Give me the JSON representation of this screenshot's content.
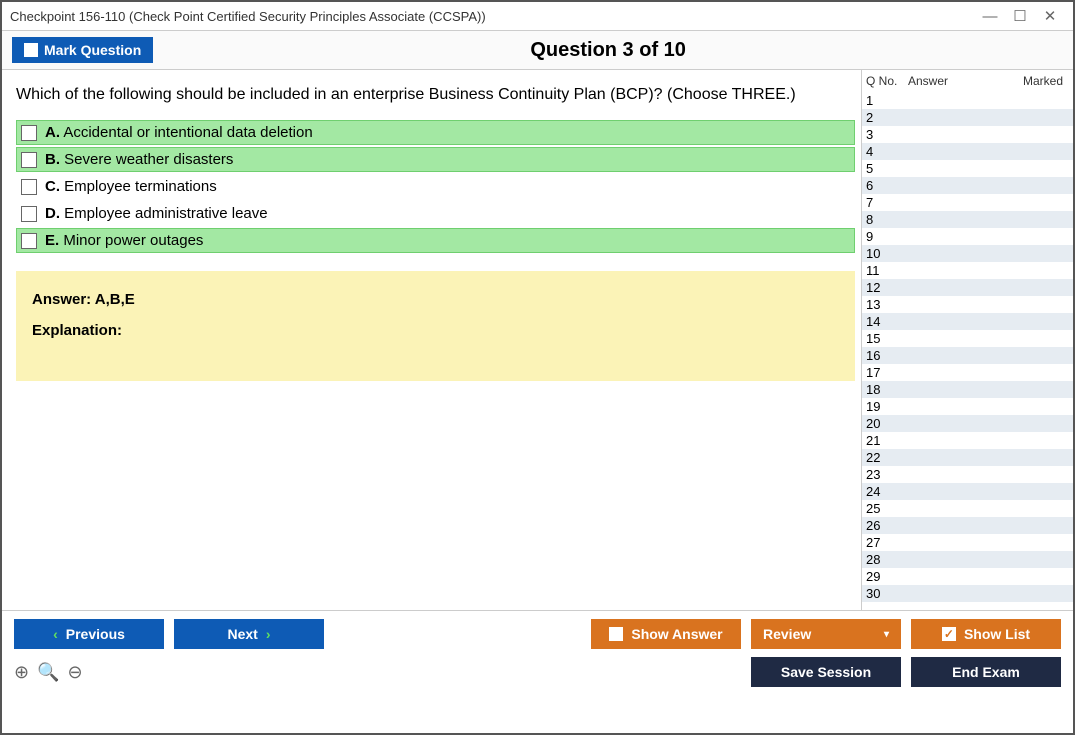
{
  "window": {
    "title": "Checkpoint 156-110 (Check Point Certified Security Principles Associate (CCSPA))"
  },
  "header": {
    "mark_label": "Mark Question",
    "question_title": "Question 3 of 10"
  },
  "question": {
    "text": "Which of the following should be included in an enterprise Business Continuity Plan (BCP)? (Choose THREE.)",
    "options": [
      {
        "letter": "A.",
        "text": "Accidental or intentional data deletion",
        "correct": true
      },
      {
        "letter": "B.",
        "text": "Severe weather disasters",
        "correct": true
      },
      {
        "letter": "C.",
        "text": "Employee terminations",
        "correct": false
      },
      {
        "letter": "D.",
        "text": "Employee administrative leave",
        "correct": false
      },
      {
        "letter": "E.",
        "text": "Minor power outages",
        "correct": true
      }
    ],
    "answer_label": "Answer: A,B,E",
    "explanation_label": "Explanation:"
  },
  "list": {
    "col_qno": "Q No.",
    "col_answer": "Answer",
    "col_marked": "Marked",
    "count": 30
  },
  "footer": {
    "previous": "Previous",
    "next": "Next",
    "show_answer": "Show Answer",
    "review": "Review",
    "show_list": "Show List",
    "save_session": "Save Session",
    "end_exam": "End Exam"
  }
}
